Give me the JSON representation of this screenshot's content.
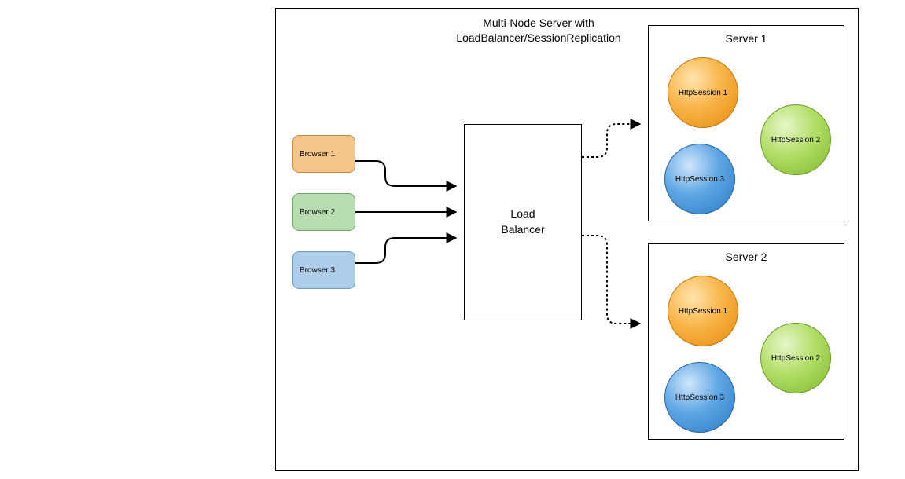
{
  "title_line1": "Multi-Node Server with",
  "title_line2": "LoadBalancer/SessionReplication",
  "browsers": [
    {
      "label": "Browser 1"
    },
    {
      "label": "Browser 2"
    },
    {
      "label": "Browser 3"
    }
  ],
  "loadbalancer": {
    "line1": "Load",
    "line2": "Balancer"
  },
  "servers": [
    {
      "title": "Server 1",
      "sessions": [
        {
          "label": "HttpSession 1",
          "color": "orange"
        },
        {
          "label": "HttpSession 2",
          "color": "green"
        },
        {
          "label": "HttpSession 3",
          "color": "blue"
        }
      ]
    },
    {
      "title": "Server 2",
      "sessions": [
        {
          "label": "HttpSession 1",
          "color": "orange"
        },
        {
          "label": "HttpSession 2",
          "color": "green"
        },
        {
          "label": "HttpSession 3",
          "color": "blue"
        }
      ]
    }
  ]
}
